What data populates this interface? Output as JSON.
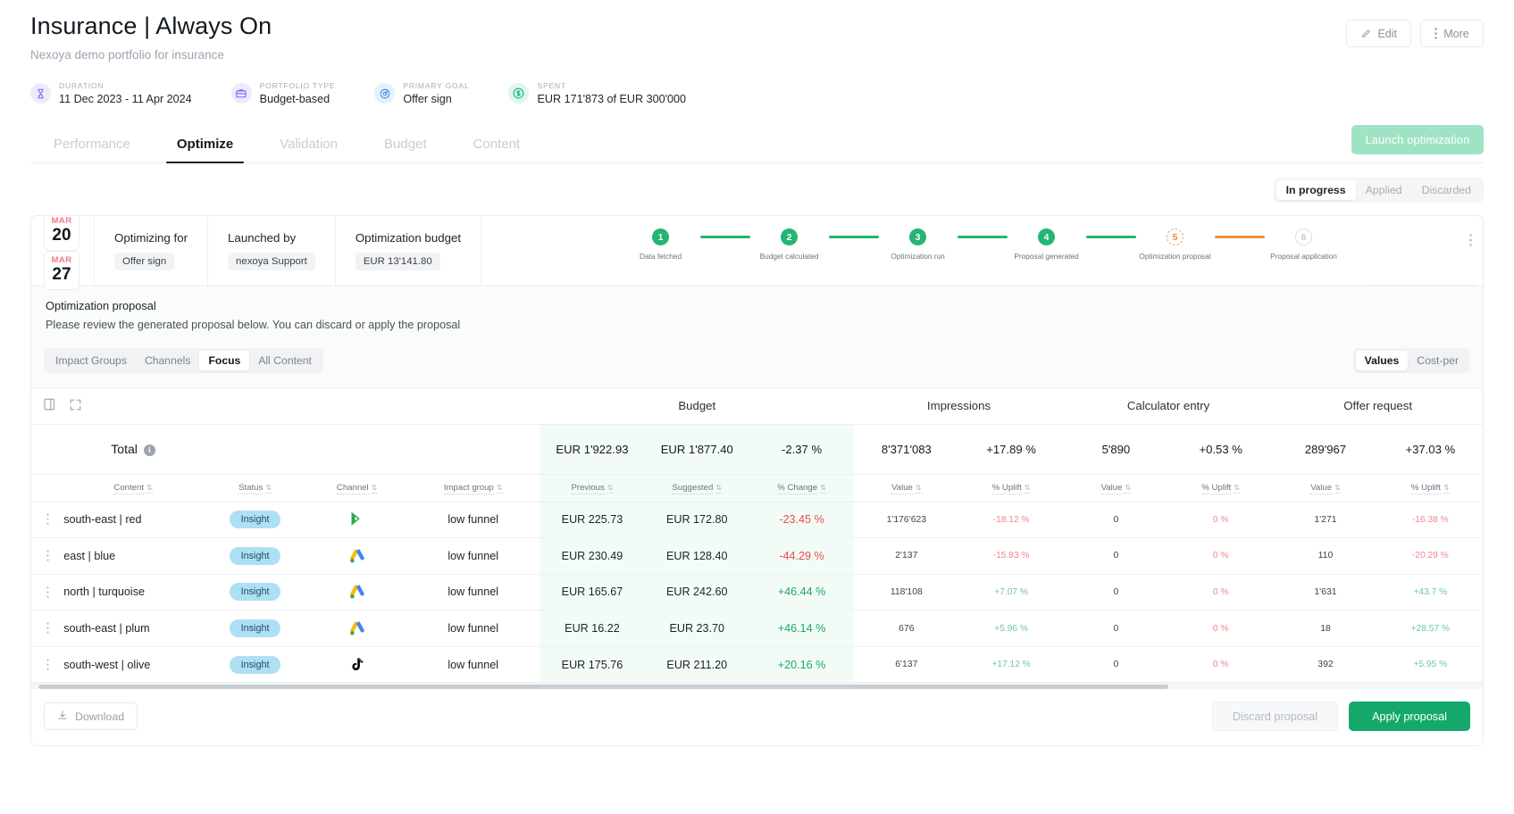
{
  "header": {
    "title": "Insurance | Always On",
    "subtitle": "Nexoya demo portfolio for insurance",
    "edit_label": "Edit",
    "more_label": "More"
  },
  "meta": [
    {
      "label": "DURATION",
      "value": "11 Dec 2023 - 11 Apr 2024",
      "icon": "hourglass-icon"
    },
    {
      "label": "PORTFOLIO TYPE",
      "value": "Budget-based",
      "icon": "briefcase-icon"
    },
    {
      "label": "PRIMARY GOAL",
      "value": "Offer sign",
      "icon": "target-icon"
    },
    {
      "label": "SPENT",
      "value": "EUR 171'873 of EUR 300'000",
      "icon": "dollar-icon"
    }
  ],
  "tabs": [
    {
      "label": "Performance",
      "active": false
    },
    {
      "label": "Optimize",
      "active": true
    },
    {
      "label": "Validation",
      "active": false
    },
    {
      "label": "Budget",
      "active": false
    },
    {
      "label": "Content",
      "active": false
    }
  ],
  "launch_button": "Launch optimization",
  "status_filter": [
    {
      "label": "In progress",
      "active": true
    },
    {
      "label": "Applied",
      "active": false
    },
    {
      "label": "Discarded",
      "active": false
    }
  ],
  "summary": {
    "start_date": {
      "month": "MAR",
      "day": "20"
    },
    "end_date": {
      "month": "MAR",
      "day": "27"
    },
    "optimizing_for_label": "Optimizing for",
    "optimizing_for_value": "Offer sign",
    "launched_by_label": "Launched by",
    "launched_by_value": "nexoya Support",
    "budget_label": "Optimization budget",
    "budget_value": "EUR 13'141.80"
  },
  "stepper": [
    {
      "num": "1",
      "label": "Data fetched",
      "state": "done"
    },
    {
      "num": "2",
      "label": "Budget calculated",
      "state": "done"
    },
    {
      "num": "3",
      "label": "Optimization run",
      "state": "done"
    },
    {
      "num": "4",
      "label": "Proposal generated",
      "state": "done"
    },
    {
      "num": "5",
      "label": "Optimization proposal",
      "state": "current"
    },
    {
      "num": "6",
      "label": "Proposal application",
      "state": "todo"
    }
  ],
  "proposal": {
    "title": "Optimization proposal",
    "subtitle": "Please review the generated proposal below. You can discard or apply the proposal"
  },
  "view_filters": [
    {
      "label": "Impact Groups",
      "active": false
    },
    {
      "label": "Channels",
      "active": false
    },
    {
      "label": "Focus",
      "active": true
    },
    {
      "label": "All Content",
      "active": false
    }
  ],
  "value_toggle": [
    {
      "label": "Values",
      "active": true
    },
    {
      "label": "Cost-per",
      "active": false
    }
  ],
  "table": {
    "group_headers": [
      "Budget",
      "Impressions",
      "Calculator entry",
      "Offer request"
    ],
    "columns": [
      "Content",
      "Status",
      "Channel",
      "Impact group",
      "Previous",
      "Suggested",
      "% Change",
      "Value",
      "% Uplift",
      "Value",
      "% Uplift",
      "Value",
      "% Uplift"
    ],
    "total": {
      "label": "Total",
      "budget_previous": "EUR 1'922.93",
      "budget_suggested": "EUR 1'877.40",
      "budget_change": "-2.37 %",
      "impressions_value": "8'371'083",
      "impressions_uplift": "+17.89 %",
      "calculator_value": "5'890",
      "calculator_uplift": "+0.53 %",
      "offer_value": "289'967",
      "offer_uplift": "+37.03 %"
    },
    "rows": [
      {
        "content": "south-east | red",
        "status": "Insight",
        "channel": "google-display-video-icon",
        "impact_group": "low funnel",
        "previous": "EUR 225.73",
        "suggested": "EUR 172.80",
        "change": "-23.45 %",
        "change_dir": "down",
        "impressions_value": "1'176'623",
        "impressions_uplift": "-18.12 %",
        "impressions_dir": "down",
        "calculator_value": "0",
        "calculator_uplift": "0 %",
        "calculator_dir": "down",
        "offer_value": "1'271",
        "offer_uplift": "-16.38 %",
        "offer_dir": "down"
      },
      {
        "content": "east | blue",
        "status": "Insight",
        "channel": "google-ads-icon",
        "impact_group": "low funnel",
        "previous": "EUR 230.49",
        "suggested": "EUR 128.40",
        "change": "-44.29 %",
        "change_dir": "down",
        "impressions_value": "2'137",
        "impressions_uplift": "-15.83 %",
        "impressions_dir": "down",
        "calculator_value": "0",
        "calculator_uplift": "0 %",
        "calculator_dir": "down",
        "offer_value": "110",
        "offer_uplift": "-20.29 %",
        "offer_dir": "down"
      },
      {
        "content": "north | turquoise",
        "status": "Insight",
        "channel": "google-ads-icon",
        "impact_group": "low funnel",
        "previous": "EUR 165.67",
        "suggested": "EUR 242.60",
        "change": "+46.44 %",
        "change_dir": "up",
        "impressions_value": "118'108",
        "impressions_uplift": "+7.07 %",
        "impressions_dir": "up",
        "calculator_value": "0",
        "calculator_uplift": "0 %",
        "calculator_dir": "down",
        "offer_value": "1'631",
        "offer_uplift": "+43.7 %",
        "offer_dir": "up"
      },
      {
        "content": "south-east | plum",
        "status": "Insight",
        "channel": "google-ads-icon",
        "impact_group": "low funnel",
        "previous": "EUR 16.22",
        "suggested": "EUR 23.70",
        "change": "+46.14 %",
        "change_dir": "up",
        "impressions_value": "676",
        "impressions_uplift": "+5.96 %",
        "impressions_dir": "up",
        "calculator_value": "0",
        "calculator_uplift": "0 %",
        "calculator_dir": "down",
        "offer_value": "18",
        "offer_uplift": "+28.57 %",
        "offer_dir": "up"
      },
      {
        "content": "south-west | olive",
        "status": "Insight",
        "channel": "tiktok-icon",
        "impact_group": "low funnel",
        "previous": "EUR 175.76",
        "suggested": "EUR 211.20",
        "change": "+20.16 %",
        "change_dir": "up",
        "impressions_value": "6'137",
        "impressions_uplift": "+17.12 %",
        "impressions_dir": "up",
        "calculator_value": "0",
        "calculator_uplift": "0 %",
        "calculator_dir": "down",
        "offer_value": "392",
        "offer_uplift": "+5.95 %",
        "offer_dir": "up"
      }
    ]
  },
  "footer": {
    "download_label": "Download",
    "discard_label": "Discard proposal",
    "apply_label": "Apply proposal"
  },
  "colors": {
    "green": "#14a86a",
    "step_green": "#22b573",
    "step_orange": "#ef8f3c",
    "red": "#ec4a53",
    "pill_blue": "#aee0f5"
  }
}
